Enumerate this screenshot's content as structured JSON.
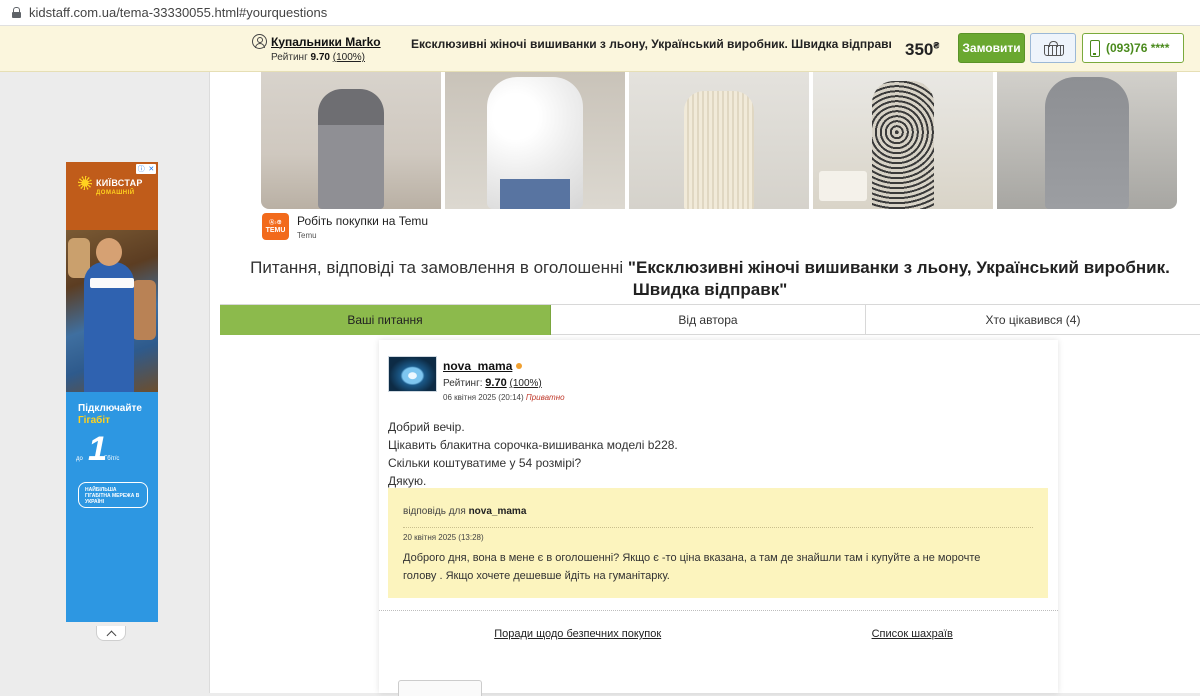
{
  "browser": {
    "url": "kidstaff.com.ua/tema-33330055.html#yourquestions"
  },
  "sticky_header": {
    "seller_name": "Купальники Marko",
    "rating_label": "Рейтинг",
    "rating_value": "9.70",
    "rating_percent": "(100%)",
    "title": "Ексклюзивні жіночі вишиванки з льону, Український виробник. Швидка відправк",
    "price": "350",
    "currency": "₴",
    "order_button": "Замовити",
    "phone": "(093)76 ****"
  },
  "ad": {
    "brand": "КИЇВСТАР",
    "brand_sub": "ДОМАШНІЙ",
    "headline_1": "Підключайте",
    "headline_2": "Гігабіт",
    "speed_prefix": "до",
    "speed_value": "1",
    "speed_unit": "Гбіт/с",
    "network_text": "НАЙБІЛЬША ГІГАБІТНА МЕРЕЖА В УКРАЇНІ"
  },
  "temu": {
    "tagline": "Робіть покупки на Temu",
    "brand": "Temu",
    "logo_top": "Ⓐ♪⊕",
    "logo_text": "TEMU"
  },
  "heading": {
    "prefix": "Питання, відповіді та замовлення в оголошенні",
    "title": "\"Ексклюзивні жіночі вишиванки з льону, Український виробник. Швидка відправк\""
  },
  "tabs": [
    {
      "label": "Ваші питання"
    },
    {
      "label": "Від автора"
    },
    {
      "label": "Хто цікавився (4)"
    }
  ],
  "question": {
    "user": "nova_mama",
    "rating_label": "Рейтинг:",
    "rating_value": "9.70",
    "rating_percent": "(100%)",
    "date": "06 квітня 2025 (20:14)",
    "privacy": "Приватно",
    "lines": [
      "Добрий вечір.",
      "Цікавить блакитна сорочка-вишиванка моделі b228.",
      "Скільки коштуватиме у 54 розмірі?",
      "Дякую."
    ]
  },
  "answer": {
    "for_label": "відповідь для",
    "for_user": "nova_mama",
    "date": "20 квітня 2025 (13:28)",
    "text": "Доброго дня, вона в мене є в оголошенні? Якщо є -то ціна вказана, а там де знайшли там і купуйте а не морочте голову . Якщо хочете дешевше йдіть на гуманітарку."
  },
  "footer_links": {
    "safety": "Поради щодо безпечних покупок",
    "scammers": "Список шахраїв"
  },
  "colors": {
    "accent_green": "#8cba4c",
    "order_green": "#6aa830",
    "sticky_bg": "#fbf6dd",
    "answer_bg": "#fcf4be"
  }
}
